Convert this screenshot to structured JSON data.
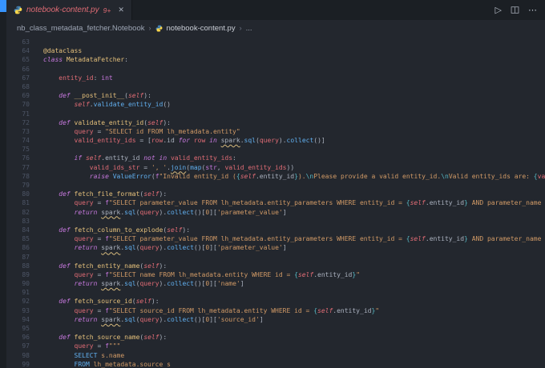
{
  "colors": {
    "accent": "#3794ff",
    "error": "#e06c75",
    "warning_squiggle": "#d7ba7d",
    "editor_bg": "#23272e",
    "chrome_bg": "#1b1f24"
  },
  "tab_bar": {
    "tab": {
      "title": "notebook-content.py",
      "badge": "9+",
      "close_label": "✕"
    },
    "actions": {
      "run": "▷",
      "more": "⋯"
    }
  },
  "breadcrumbs": {
    "root": "nb_class_metadata_fetcher.Notebook",
    "file": "notebook-content.py",
    "more": "...",
    "separator": "›"
  },
  "editor": {
    "lines": [
      {
        "n": "63",
        "toks": []
      },
      {
        "n": "64",
        "toks": [
          [
            "cls",
            "@dataclass"
          ]
        ]
      },
      {
        "n": "65",
        "toks": [
          [
            "k",
            "class "
          ],
          [
            "cls",
            "MetadataFetcher"
          ],
          [
            "p",
            ":"
          ]
        ]
      },
      {
        "n": "66",
        "toks": []
      },
      {
        "n": "67",
        "toks": [
          [
            "p",
            "    "
          ],
          [
            "v",
            "entity_id"
          ],
          [
            "p",
            ": "
          ],
          [
            "t",
            "int"
          ]
        ]
      },
      {
        "n": "68",
        "toks": []
      },
      {
        "n": "69",
        "toks": [
          [
            "p",
            "    "
          ],
          [
            "k",
            "def "
          ],
          [
            "fn",
            "__post_init__"
          ],
          [
            "p",
            "("
          ],
          [
            "slf",
            "self"
          ],
          [
            "p",
            "):"
          ]
        ]
      },
      {
        "n": "70",
        "toks": [
          [
            "p",
            "        "
          ],
          [
            "slf",
            "self"
          ],
          [
            "p",
            "."
          ],
          [
            "c",
            "validate_entity_id"
          ],
          [
            "p",
            "()"
          ]
        ]
      },
      {
        "n": "71",
        "toks": []
      },
      {
        "n": "72",
        "toks": [
          [
            "p",
            "    "
          ],
          [
            "k",
            "def "
          ],
          [
            "fn",
            "validate_entity_id"
          ],
          [
            "p",
            "("
          ],
          [
            "slf",
            "self"
          ],
          [
            "p",
            "):"
          ]
        ]
      },
      {
        "n": "73",
        "toks": [
          [
            "p",
            "        "
          ],
          [
            "v",
            "query"
          ],
          [
            "p",
            " = "
          ],
          [
            "s",
            "\"SELECT id FROM lh_metadata.entity\""
          ]
        ]
      },
      {
        "n": "74",
        "toks": [
          [
            "p",
            "        "
          ],
          [
            "v",
            "valid_entity_ids"
          ],
          [
            "p",
            " = ["
          ],
          [
            "v",
            "row"
          ],
          [
            "p",
            ".id "
          ],
          [
            "k",
            "for"
          ],
          [
            "p",
            " "
          ],
          [
            "v",
            "row"
          ],
          [
            "p",
            " "
          ],
          [
            "k",
            "in"
          ],
          [
            "p",
            " "
          ],
          [
            "squig",
            "spark"
          ],
          [
            "p",
            "."
          ],
          [
            "c",
            "sql"
          ],
          [
            "p",
            "("
          ],
          [
            "v",
            "query"
          ],
          [
            "p",
            ")."
          ],
          [
            "c",
            "collect"
          ],
          [
            "p",
            "()]"
          ]
        ]
      },
      {
        "n": "75",
        "toks": []
      },
      {
        "n": "76",
        "toks": [
          [
            "p",
            "        "
          ],
          [
            "k",
            "if "
          ],
          [
            "slf",
            "self"
          ],
          [
            "p",
            ".entity_id "
          ],
          [
            "k",
            "not in"
          ],
          [
            "p",
            " "
          ],
          [
            "v",
            "valid_entity_ids"
          ],
          [
            "p",
            ":"
          ]
        ]
      },
      {
        "n": "77",
        "toks": [
          [
            "p",
            "            "
          ],
          [
            "v",
            "valid_ids_str"
          ],
          [
            "p",
            " = "
          ],
          [
            "s",
            "', '"
          ],
          [
            "p",
            "."
          ],
          [
            "cs",
            "join"
          ],
          [
            "p",
            "("
          ],
          [
            "c",
            "map"
          ],
          [
            "p",
            "("
          ],
          [
            "t",
            "str"
          ],
          [
            "p",
            ", "
          ],
          [
            "v",
            "valid_entity_ids"
          ],
          [
            "p",
            "))"
          ]
        ]
      },
      {
        "n": "78",
        "toks": [
          [
            "p",
            "            "
          ],
          [
            "k",
            "raise "
          ],
          [
            "c",
            "ValueError"
          ],
          [
            "p",
            "("
          ],
          [
            "t",
            "f"
          ],
          [
            "s",
            "\"Invalid entity_id ("
          ],
          [
            "br",
            "{"
          ],
          [
            "slf",
            "self"
          ],
          [
            "p",
            ".entity_id"
          ],
          [
            "br",
            "}"
          ],
          [
            "s",
            ")."
          ],
          [
            "esc",
            "\\n"
          ],
          [
            "s",
            "Please provide a valid entity_id."
          ],
          [
            "esc",
            "\\n"
          ],
          [
            "s",
            "Valid entity_ids are: "
          ],
          [
            "br",
            "{"
          ],
          [
            "v",
            "valid_id"
          ]
        ]
      },
      {
        "n": "79",
        "toks": []
      },
      {
        "n": "80",
        "toks": [
          [
            "p",
            "    "
          ],
          [
            "k",
            "def "
          ],
          [
            "fn",
            "fetch_file_format"
          ],
          [
            "p",
            "("
          ],
          [
            "slf",
            "self"
          ],
          [
            "p",
            "):"
          ]
        ]
      },
      {
        "n": "81",
        "toks": [
          [
            "p",
            "        "
          ],
          [
            "v",
            "query"
          ],
          [
            "p",
            " = "
          ],
          [
            "t",
            "f"
          ],
          [
            "s",
            "\"SELECT parameter_value FROM lh_metadata.entity_parameters WHERE entity_id = "
          ],
          [
            "br",
            "{"
          ],
          [
            "slf",
            "self"
          ],
          [
            "p",
            ".entity_id"
          ],
          [
            "br",
            "}"
          ],
          [
            "s",
            " AND parameter_name = 'sink"
          ]
        ]
      },
      {
        "n": "82",
        "toks": [
          [
            "p",
            "        "
          ],
          [
            "k",
            "return "
          ],
          [
            "squig",
            "spark"
          ],
          [
            "p",
            "."
          ],
          [
            "c",
            "sql"
          ],
          [
            "p",
            "("
          ],
          [
            "v",
            "query"
          ],
          [
            "p",
            ")."
          ],
          [
            "c",
            "collect"
          ],
          [
            "p",
            "()["
          ],
          [
            "num",
            "0"
          ],
          [
            "p",
            "]["
          ],
          [
            "s",
            "'parameter_value'"
          ],
          [
            "p",
            "]"
          ]
        ]
      },
      {
        "n": "83",
        "toks": []
      },
      {
        "n": "84",
        "toks": [
          [
            "p",
            "    "
          ],
          [
            "k",
            "def "
          ],
          [
            "fn",
            "fetch_column_to_explode"
          ],
          [
            "p",
            "("
          ],
          [
            "slf",
            "self"
          ],
          [
            "p",
            "):"
          ]
        ]
      },
      {
        "n": "85",
        "toks": [
          [
            "p",
            "        "
          ],
          [
            "v",
            "query"
          ],
          [
            "p",
            " = "
          ],
          [
            "t",
            "f"
          ],
          [
            "s",
            "\"SELECT parameter_value FROM lh_metadata.entity_parameters WHERE entity_id = "
          ],
          [
            "br",
            "{"
          ],
          [
            "slf",
            "self"
          ],
          [
            "p",
            ".entity_id"
          ],
          [
            "br",
            "}"
          ],
          [
            "s",
            " AND parameter_name = 'colu"
          ]
        ]
      },
      {
        "n": "86",
        "toks": [
          [
            "p",
            "        "
          ],
          [
            "k",
            "return "
          ],
          [
            "squig",
            "spark"
          ],
          [
            "p",
            "."
          ],
          [
            "c",
            "sql"
          ],
          [
            "p",
            "("
          ],
          [
            "v",
            "query"
          ],
          [
            "p",
            ")."
          ],
          [
            "c",
            "collect"
          ],
          [
            "p",
            "()["
          ],
          [
            "num",
            "0"
          ],
          [
            "p",
            "]["
          ],
          [
            "s",
            "'parameter_value'"
          ],
          [
            "p",
            "]"
          ]
        ]
      },
      {
        "n": "87",
        "toks": []
      },
      {
        "n": "88",
        "toks": [
          [
            "p",
            "    "
          ],
          [
            "k",
            "def "
          ],
          [
            "fn",
            "fetch_entity_name"
          ],
          [
            "p",
            "("
          ],
          [
            "slf",
            "self"
          ],
          [
            "p",
            "):"
          ]
        ]
      },
      {
        "n": "89",
        "toks": [
          [
            "p",
            "        "
          ],
          [
            "v",
            "query"
          ],
          [
            "p",
            " = "
          ],
          [
            "t",
            "f"
          ],
          [
            "s",
            "\"SELECT name FROM lh_metadata.entity WHERE id = "
          ],
          [
            "br",
            "{"
          ],
          [
            "slf",
            "self"
          ],
          [
            "p",
            ".entity_id"
          ],
          [
            "br",
            "}"
          ],
          [
            "s",
            "\""
          ]
        ]
      },
      {
        "n": "90",
        "toks": [
          [
            "p",
            "        "
          ],
          [
            "k",
            "return "
          ],
          [
            "squig",
            "spark"
          ],
          [
            "p",
            "."
          ],
          [
            "c",
            "sql"
          ],
          [
            "p",
            "("
          ],
          [
            "v",
            "query"
          ],
          [
            "p",
            ")."
          ],
          [
            "c",
            "collect"
          ],
          [
            "p",
            "()["
          ],
          [
            "num",
            "0"
          ],
          [
            "p",
            "]["
          ],
          [
            "s",
            "'name'"
          ],
          [
            "p",
            "]"
          ]
        ]
      },
      {
        "n": "91",
        "toks": []
      },
      {
        "n": "92",
        "toks": [
          [
            "p",
            "    "
          ],
          [
            "k",
            "def "
          ],
          [
            "fn",
            "fetch_source_id"
          ],
          [
            "p",
            "("
          ],
          [
            "slf",
            "self"
          ],
          [
            "p",
            "):"
          ]
        ]
      },
      {
        "n": "93",
        "toks": [
          [
            "p",
            "        "
          ],
          [
            "v",
            "query"
          ],
          [
            "p",
            " = "
          ],
          [
            "t",
            "f"
          ],
          [
            "s",
            "\"SELECT source_id FROM lh_metadata.entity WHERE id = "
          ],
          [
            "br",
            "{"
          ],
          [
            "slf",
            "self"
          ],
          [
            "p",
            ".entity_id"
          ],
          [
            "br",
            "}"
          ],
          [
            "s",
            "\""
          ]
        ]
      },
      {
        "n": "94",
        "toks": [
          [
            "p",
            "        "
          ],
          [
            "k",
            "return "
          ],
          [
            "squig",
            "spark"
          ],
          [
            "p",
            "."
          ],
          [
            "c",
            "sql"
          ],
          [
            "p",
            "("
          ],
          [
            "v",
            "query"
          ],
          [
            "p",
            ")."
          ],
          [
            "c",
            "collect"
          ],
          [
            "p",
            "()["
          ],
          [
            "num",
            "0"
          ],
          [
            "p",
            "]["
          ],
          [
            "s",
            "'source_id'"
          ],
          [
            "p",
            "]"
          ]
        ]
      },
      {
        "n": "95",
        "toks": []
      },
      {
        "n": "96",
        "toks": [
          [
            "p",
            "    "
          ],
          [
            "k",
            "def "
          ],
          [
            "fn",
            "fetch_source_name"
          ],
          [
            "p",
            "("
          ],
          [
            "slf",
            "self"
          ],
          [
            "p",
            "):"
          ]
        ]
      },
      {
        "n": "97",
        "toks": [
          [
            "p",
            "        "
          ],
          [
            "v",
            "query"
          ],
          [
            "p",
            " = "
          ],
          [
            "t",
            "f"
          ],
          [
            "s",
            "\"\"\""
          ]
        ]
      },
      {
        "n": "98",
        "toks": [
          [
            "p",
            "        "
          ],
          [
            "c",
            "SELECT"
          ],
          [
            "s",
            " s.name"
          ]
        ]
      },
      {
        "n": "99",
        "toks": [
          [
            "p",
            "        "
          ],
          [
            "c",
            "FROM"
          ],
          [
            "s",
            " lh_metadata.source s"
          ]
        ]
      }
    ]
  }
}
